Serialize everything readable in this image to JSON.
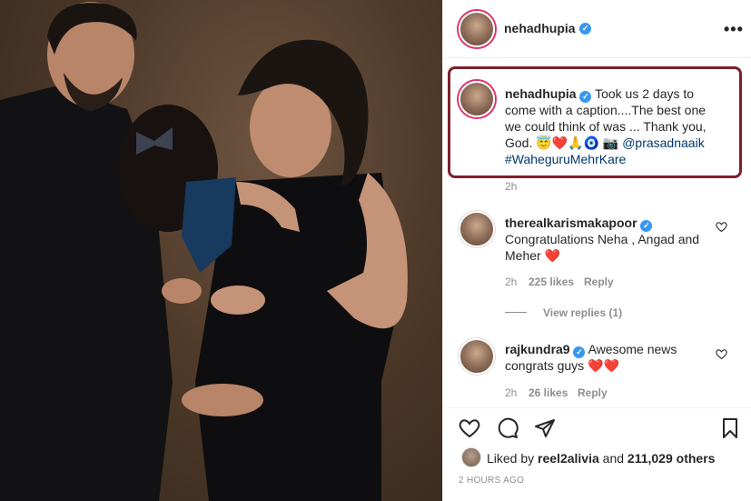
{
  "post": {
    "username": "nehadhupia",
    "verified_mark": "✓",
    "more_icon": "•••"
  },
  "caption": {
    "username": "nehadhupia",
    "text": "Took us 2 days to come with a caption....The best one we could think of was ... Thank you, God.",
    "emojis": "😇❤️🙏🧿 📷",
    "mention": "@prasadnaaik",
    "hashtag": "#WaheguruMehrKare",
    "time": "2h"
  },
  "comments": [
    {
      "username": "therealkarismakapoor",
      "text": "Congratulations Neha , Angad and Meher",
      "emoji": "❤️",
      "time": "2h",
      "likes": "225 likes",
      "reply": "Reply",
      "view_replies": "View replies (1)"
    },
    {
      "username": "rajkundra9",
      "text": "Awesome news congrats guys",
      "emoji": "❤️❤️",
      "time": "2h",
      "likes": "26 likes",
      "reply": "Reply"
    }
  ],
  "actions": {
    "icons": [
      "heart-icon",
      "comment-icon",
      "share-icon",
      "bookmark-icon"
    ]
  },
  "liked_by": {
    "prefix": "Liked by",
    "user": "reel2alivia",
    "middle": "and",
    "count": "211,029 others"
  },
  "posted": "2 HOURS AGO",
  "colors": {
    "highlight_border": "#7e1f2b",
    "verified": "#3897f0",
    "heart_red": "#ed4956",
    "meta_gray": "#8e8e8e"
  }
}
